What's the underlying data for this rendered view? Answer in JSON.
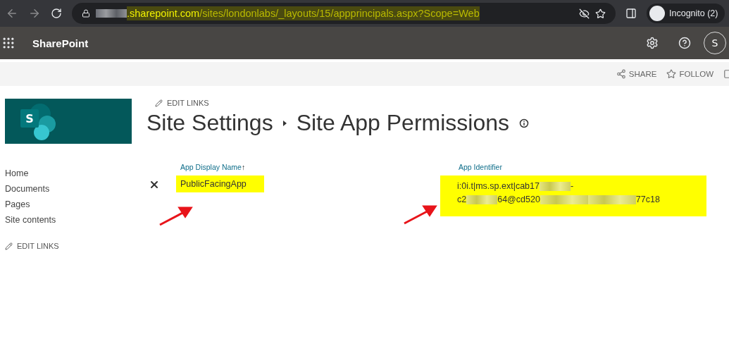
{
  "browser": {
    "url": {
      "host": ".sharepoint.com",
      "path": "/sites/londonlabs/_layouts/15/appprincipals.aspx?Scope=Web",
      "highlighted": true
    },
    "profile": {
      "label": "Incognito (2)"
    }
  },
  "suite_bar": {
    "app_name": "SharePoint",
    "avatar_initial": "S"
  },
  "command_bar": {
    "actions": [
      {
        "kind": "share",
        "label": "SHARE"
      },
      {
        "kind": "follow",
        "label": "FOLLOW"
      }
    ]
  },
  "site": {
    "logo_letter": "S"
  },
  "nav": {
    "items": [
      "Home",
      "Documents",
      "Pages",
      "Site contents"
    ],
    "edit_links": "EDIT LINKS"
  },
  "page": {
    "edit_links": "EDIT LINKS",
    "breadcrumb": [
      "Site Settings",
      "Site App Permissions"
    ]
  },
  "table": {
    "columns": [
      {
        "label": "App Display Name",
        "sort_mark": "↑"
      },
      {
        "label": "App Identifier"
      }
    ],
    "rows": [
      {
        "name": "PublicFacingApp",
        "name_highlighted": true,
        "identifier_highlighted": true,
        "identifier": [
          [
            {
              "kind": "text",
              "text": "i:0i.t|ms.sp.ext|cab17"
            },
            {
              "kind": "redacted"
            },
            {
              "kind": "text",
              "text": "-"
            }
          ],
          [
            {
              "kind": "text",
              "text": "c2"
            },
            {
              "kind": "redacted"
            },
            {
              "kind": "text",
              "text": "64@cd520"
            },
            {
              "kind": "redacted"
            },
            {
              "kind": "redacted"
            },
            {
              "kind": "text",
              "text": "77c18"
            }
          ]
        ]
      }
    ]
  }
}
